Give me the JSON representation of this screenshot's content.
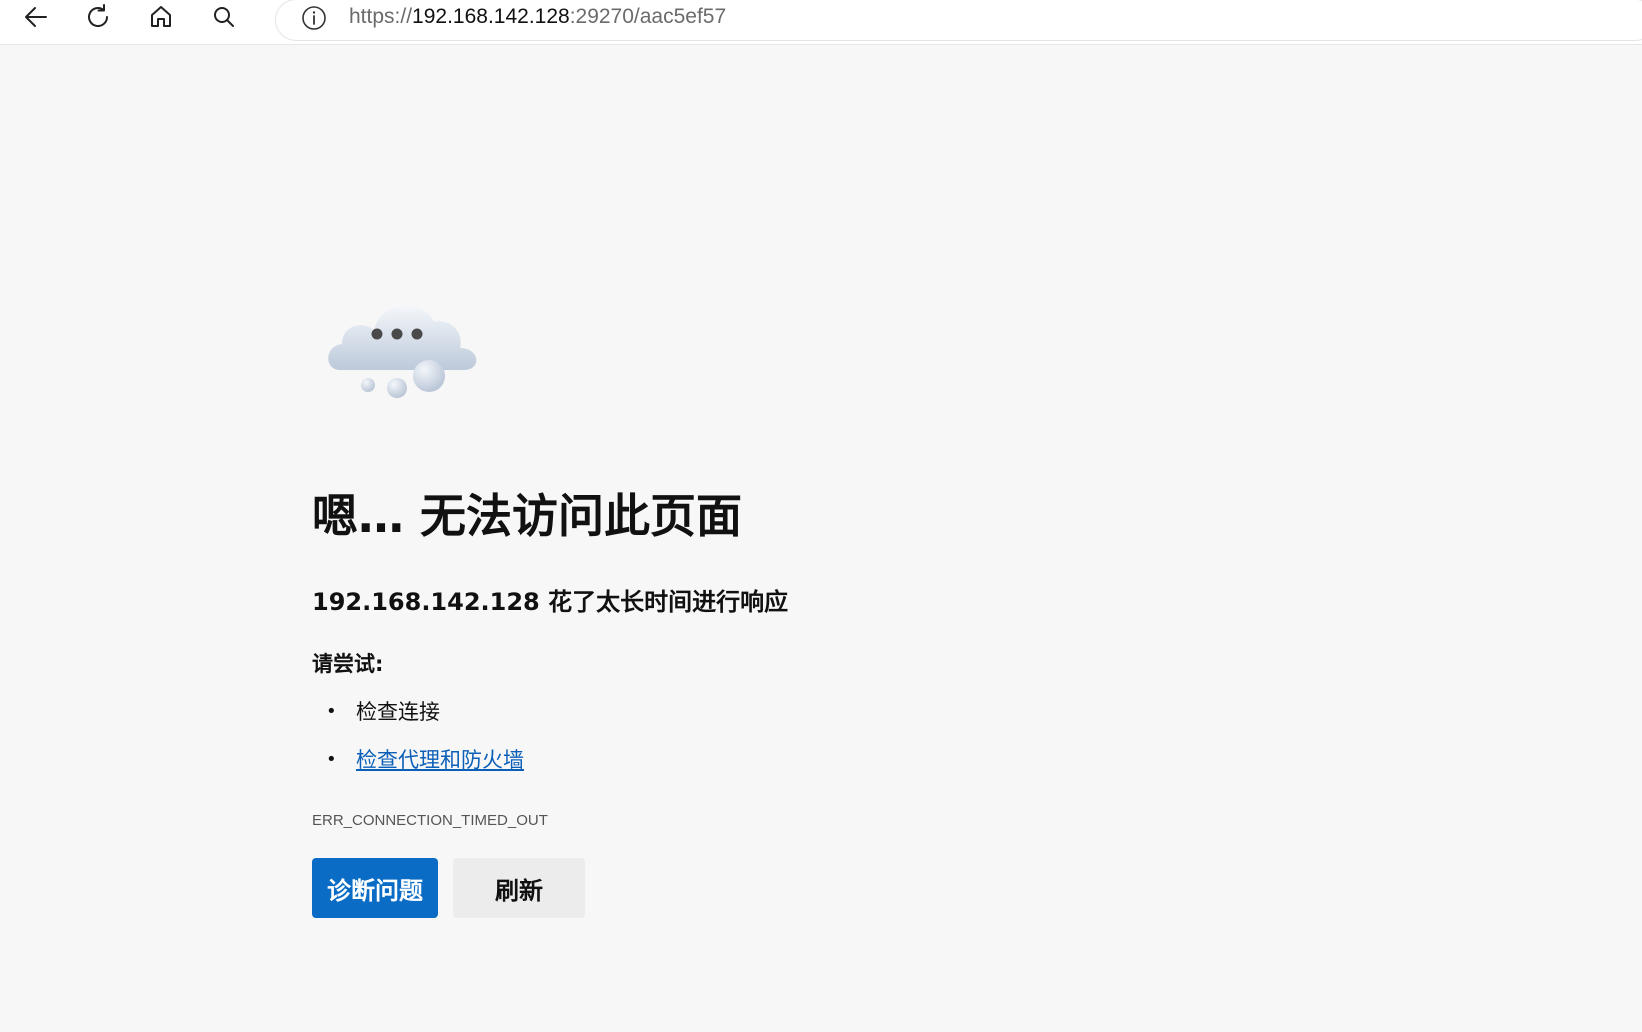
{
  "browser": {
    "back_icon": "arrow-left-icon",
    "refresh_icon": "refresh-icon",
    "home_icon": "home-icon",
    "search_icon": "search-icon",
    "info_icon": "info-icon",
    "url_scheme": "https://",
    "url_host": "192.168.142.128",
    "url_rest": ":29270/aac5ef57"
  },
  "error_page": {
    "illustration_icon": "cloud-thinking-icon",
    "title": "嗯… 无法访问此页面",
    "subtitle": "192.168.142.128 花了太长时间进行响应",
    "try_label": "请尝试:",
    "suggestions": [
      {
        "text": "检查连接",
        "is_link": false
      },
      {
        "text": "检查代理和防火墙",
        "is_link": true
      }
    ],
    "error_code": "ERR_CONNECTION_TIMED_OUT",
    "diagnose_button": "诊断问题",
    "refresh_button": "刷新",
    "accent_color": "#0a6cc4",
    "link_color": "#0b5fb8"
  }
}
